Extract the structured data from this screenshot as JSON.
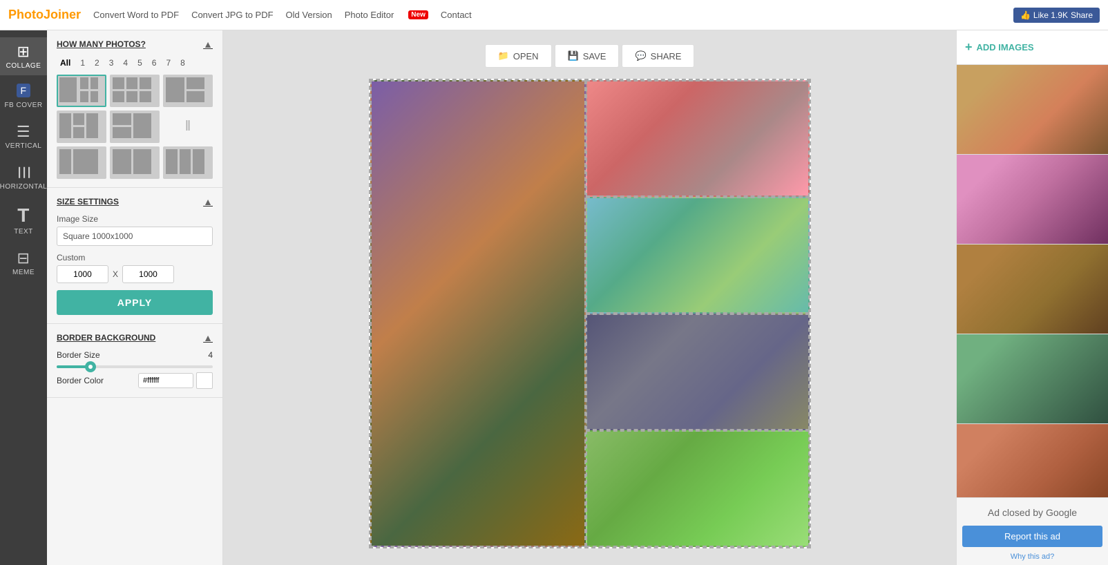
{
  "nav": {
    "logo_photo": "Photo",
    "logo_joiner": "Joiner",
    "links": [
      {
        "label": "Convert Word to PDF",
        "href": "#"
      },
      {
        "label": "Convert JPG to PDF",
        "href": "#"
      },
      {
        "label": "Old Version",
        "href": "#"
      },
      {
        "label": "Photo Editor",
        "href": "#"
      },
      {
        "label": "New",
        "badge": true
      },
      {
        "label": "Contact",
        "href": "#",
        "dropdown": true
      }
    ],
    "like_count": "Like 1.9K",
    "share_label": "Share"
  },
  "sidebar": {
    "items": [
      {
        "id": "collage",
        "label": "COLLAGE",
        "active": true
      },
      {
        "id": "fb-cover",
        "label": "FB COVER"
      },
      {
        "id": "vertical",
        "label": "VERTICAL"
      },
      {
        "id": "horizontal",
        "label": "HORIZONTAL"
      },
      {
        "id": "text",
        "label": "TEXT"
      },
      {
        "id": "meme",
        "label": "MEME"
      }
    ]
  },
  "panel": {
    "how_many_photos": {
      "title": "HOW MANY PHOTOS?",
      "tabs": [
        "All",
        "1",
        "2",
        "3",
        "4",
        "5",
        "6",
        "7",
        "8"
      ],
      "active_tab": "All"
    },
    "size_settings": {
      "title": "SIZE SETTINGS",
      "image_size_label": "Image Size",
      "image_size_value": "Square 1000x1000",
      "custom_label": "Custom",
      "width": "1000",
      "height": "1000",
      "x_label": "X",
      "apply_label": "APPLY"
    },
    "border_background": {
      "title": "BORDER BACKGROUND",
      "border_size_label": "Border Size",
      "border_size_value": "4",
      "border_color_label": "Border Color",
      "border_color_hex": "#ffffff"
    }
  },
  "toolbar": {
    "open_label": "OPEN",
    "save_label": "SAVE",
    "share_label": "SHARE"
  },
  "right_sidebar": {
    "add_images_label": "ADD IMAGES",
    "images": [
      {
        "id": 1,
        "class": "thumb-1"
      },
      {
        "id": 2,
        "class": "thumb-2"
      },
      {
        "id": 3,
        "class": "thumb-3"
      },
      {
        "id": 4,
        "class": "thumb-4"
      },
      {
        "id": 5,
        "class": "thumb-5"
      }
    ]
  },
  "ad": {
    "closed_text": "Ad closed by Google",
    "report_label": "Report this ad",
    "why_label": "Why this ad?"
  }
}
